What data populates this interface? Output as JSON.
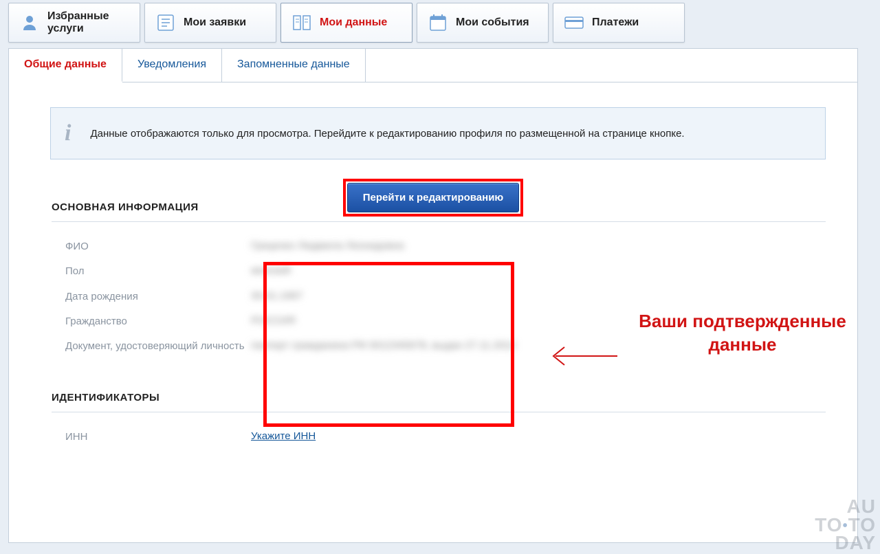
{
  "nav": {
    "favorites": "Избранные услуги",
    "requests": "Мои заявки",
    "mydata": "Мои данные",
    "events": "Мои события",
    "payments": "Платежи"
  },
  "subtabs": {
    "general": "Общие данные",
    "notifications": "Уведомления",
    "saved": "Запомненные данные"
  },
  "banner": "Данные отображаются только для просмотра. Перейдите к редактированию профиля по размещенной на странице кнопке.",
  "edit_button": "Перейти к редактированию",
  "sections": {
    "main_info": "ОСНОВНАЯ ИНФОРМАЦИЯ",
    "identifiers": "ИДЕНТИФИКАТОРЫ"
  },
  "fields": {
    "fio": "ФИО",
    "gender": "Пол",
    "dob": "Дата рождения",
    "citizenship": "Гражданство",
    "iddoc": "Документ, удостоверяющий личность",
    "inn": "ИНН"
  },
  "values": {
    "fio": "Гриценко Людмила Леонидовна",
    "gender": "женский",
    "dob": "30.01.1967",
    "citizenship": "РОССИЯ",
    "iddoc": "паспорт гражданина РФ 0012345678, выдан 27.11.2012"
  },
  "links": {
    "inn": "Укажите ИНН"
  },
  "annotation": "Ваши подтвержденные данные",
  "watermark": {
    "l1": "AU",
    "l2": "TO",
    "l3": "TO",
    "l4": "DAY"
  }
}
